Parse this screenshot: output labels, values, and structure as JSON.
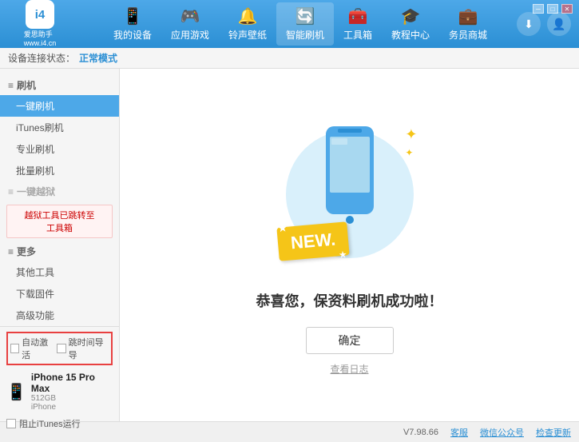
{
  "app": {
    "logo_text": "i4",
    "logo_subtext": "爱思助手\nwww.i4.cn",
    "window_title": "爱思助手"
  },
  "nav": {
    "items": [
      {
        "id": "my-device",
        "label": "我的设备",
        "icon": "📱"
      },
      {
        "id": "apps",
        "label": "应用游戏",
        "icon": "🎮"
      },
      {
        "id": "ringtone",
        "label": "铃声壁纸",
        "icon": "🔔"
      },
      {
        "id": "smart-flash",
        "label": "智能刷机",
        "icon": "🔄",
        "active": true
      },
      {
        "id": "toolbox",
        "label": "工具箱",
        "icon": "🧰"
      },
      {
        "id": "tutorial",
        "label": "教程中心",
        "icon": "🎓"
      },
      {
        "id": "store",
        "label": "务员商城",
        "icon": "💼"
      }
    ],
    "download_icon": "⬇",
    "user_icon": "👤"
  },
  "sidebar": {
    "section_flash": "刷机",
    "items": [
      {
        "id": "one-key-flash",
        "label": "一键刷机",
        "active": true
      },
      {
        "id": "itunes-flash",
        "label": "iTunes刷机"
      },
      {
        "id": "pro-flash",
        "label": "专业刷机"
      },
      {
        "id": "batch-flash",
        "label": "批量刷机"
      }
    ],
    "section_activation": "一键越狱",
    "activation_disabled": true,
    "activation_notice": "越狱工具已跳转至\n工具箱",
    "section_more": "更多",
    "more_items": [
      {
        "id": "other-tools",
        "label": "其他工具"
      },
      {
        "id": "download-firmware",
        "label": "下载固件"
      },
      {
        "id": "advanced",
        "label": "高级功能"
      }
    ]
  },
  "device_panel": {
    "auto_activate_label": "自动激活",
    "time_guide_label": "跳时间导导",
    "device_name": "iPhone 15 Pro Max",
    "device_storage": "512GB",
    "device_type": "iPhone",
    "itunes_label": "阻止iTunes运行"
  },
  "content": {
    "success_message": "恭喜您，保资料刷机成功啦！",
    "confirm_button": "确定",
    "view_log_label": "查看日志"
  },
  "status_bar": {
    "mode_prefix": "设备连接状态：",
    "mode": "正常模式",
    "version": "V7.98.66",
    "links": [
      "客服",
      "微信公众号",
      "检查更新"
    ]
  },
  "window_controls": {
    "minimize": "─",
    "restore": "□",
    "close": "✕"
  }
}
